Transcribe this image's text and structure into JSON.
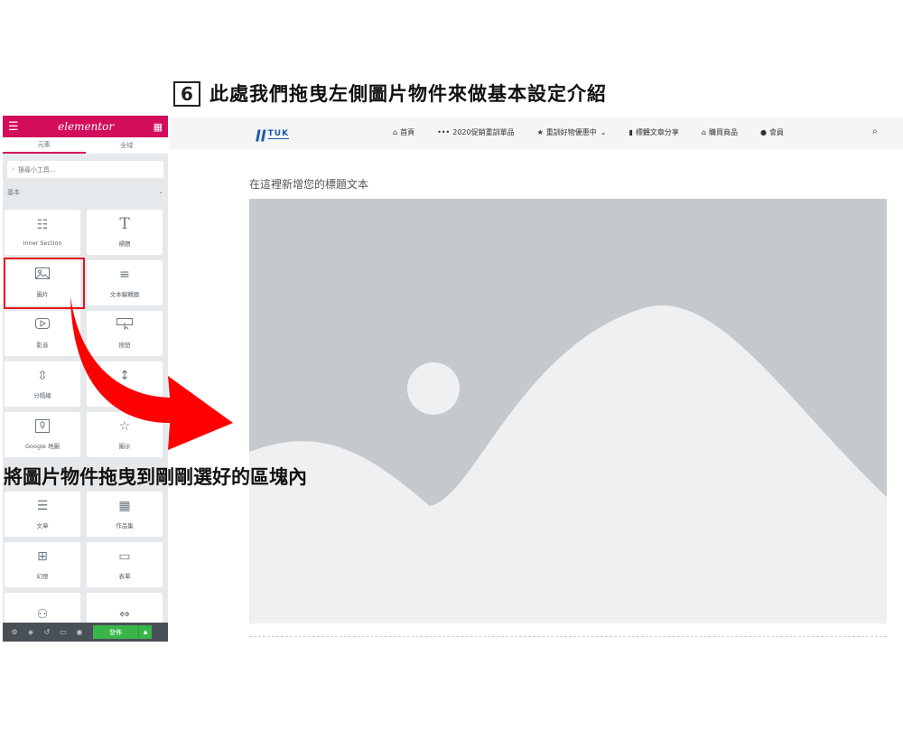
{
  "instruction": {
    "step_number": "6",
    "title": "此處我們拖曳左側圖片物件來做基本設定介紹",
    "caption": "將圖片物件拖曳到剛剛選好的區塊內"
  },
  "panel": {
    "logo": "elementor",
    "tabs": [
      {
        "label": "元素",
        "active": true
      },
      {
        "label": "全域",
        "active": false
      }
    ],
    "search_placeholder": "搜尋小工具...",
    "category": "基本",
    "widgets": [
      {
        "label": "Inner Section",
        "icon": "columns-icon"
      },
      {
        "label": "標題",
        "icon": "heading-icon"
      },
      {
        "label": "圖片",
        "icon": "image-icon"
      },
      {
        "label": "文本編輯器",
        "icon": "text-editor-icon"
      },
      {
        "label": "影音",
        "icon": "video-icon"
      },
      {
        "label": "按鈕",
        "icon": "button-icon"
      },
      {
        "label": "分隔線",
        "icon": "divider-icon"
      },
      {
        "label": "間隔",
        "icon": "spacer-icon"
      },
      {
        "label": "Google 地圖",
        "icon": "map-icon"
      },
      {
        "label": "圖示",
        "icon": "star-icon"
      },
      {
        "label": "文章",
        "icon": "posts-icon"
      },
      {
        "label": "作品集",
        "icon": "portfolio-icon"
      },
      {
        "label": "幻燈",
        "icon": "slides-icon"
      },
      {
        "label": "表單",
        "icon": "form-icon"
      },
      {
        "label": "",
        "icon": "login-icon"
      },
      {
        "label": "",
        "icon": "nav-menu-icon"
      }
    ],
    "footer": {
      "publish": "發佈"
    },
    "accent_color": "#d30c5c"
  },
  "site": {
    "logo_text": "TUK",
    "nav": [
      {
        "label": "首頁",
        "icon": "home-icon"
      },
      {
        "label": "2020促銷重訓單品",
        "icon": "dots-icon"
      },
      {
        "label": "重訓好物優惠中",
        "icon": "star-icon"
      },
      {
        "label": "標體文章分享",
        "icon": "book-icon"
      },
      {
        "label": "購買商品",
        "icon": "store-icon"
      },
      {
        "label": "會員",
        "icon": "user-icon"
      }
    ],
    "heading": "在這裡新增您的標題文本"
  }
}
